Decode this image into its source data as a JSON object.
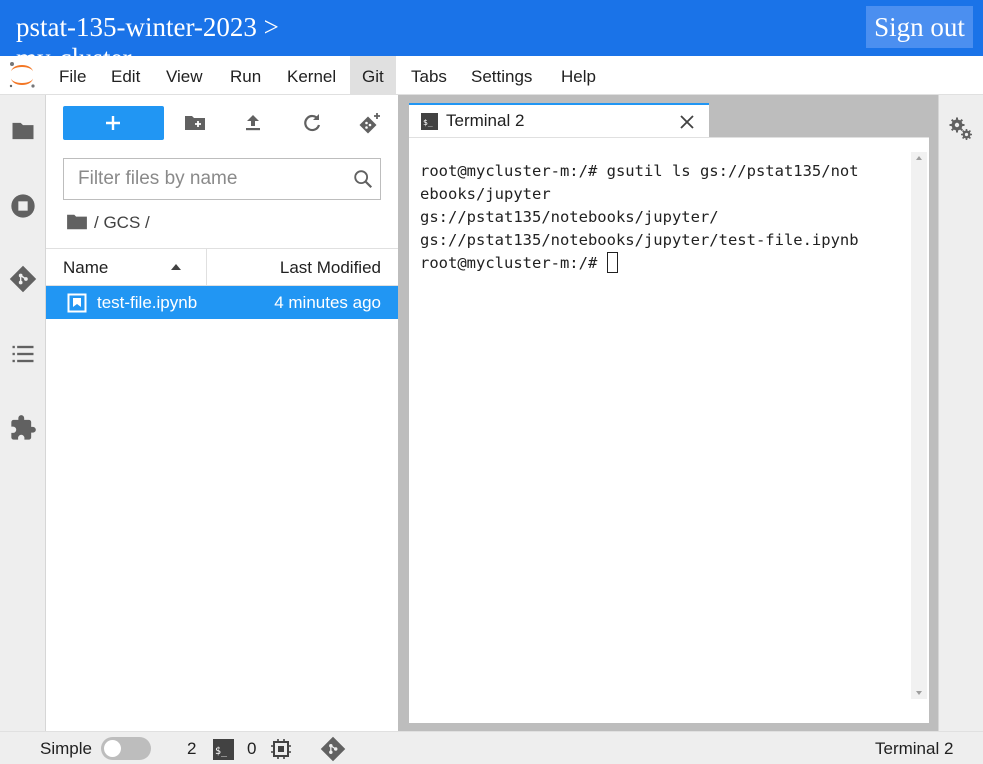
{
  "banner": {
    "title": "pstat-135-winter-2023  >",
    "subtitle": "my-cluster",
    "sign_out_label": "Sign out",
    "color": "#1a73e8"
  },
  "menu": {
    "items": [
      "File",
      "Edit",
      "View",
      "Run",
      "Kernel",
      "Git",
      "Tabs",
      "Settings",
      "Help"
    ],
    "active": "Git"
  },
  "activity_bar": {
    "icons": [
      "folder-icon",
      "running-icon",
      "git-icon",
      "table-of-contents-icon",
      "extension-icon"
    ]
  },
  "file_browser": {
    "new_button_label": "+",
    "filter_placeholder": "Filter files by name",
    "breadcrumb": "/ GCS /",
    "columns": {
      "name": "Name",
      "last_modified": "Last Modified"
    },
    "files": [
      {
        "name": "test-file.ipynb",
        "modified": "4 minutes ago",
        "selected": true
      }
    ]
  },
  "tab": {
    "label": "Terminal 2"
  },
  "terminal": {
    "lines": [
      "root@mycluster-m:/# gsutil ls gs://pstat135/not",
      "ebooks/jupyter",
      "gs://pstat135/notebooks/jupyter/",
      "gs://pstat135/notebooks/jupyter/test-file.ipynb",
      "root@mycluster-m:/# "
    ]
  },
  "statusbar": {
    "mode_label": "Simple",
    "terminal_count": "2",
    "kernel_count": "0",
    "current_activity": "Terminal 2"
  },
  "accent_color": "#2196f3"
}
